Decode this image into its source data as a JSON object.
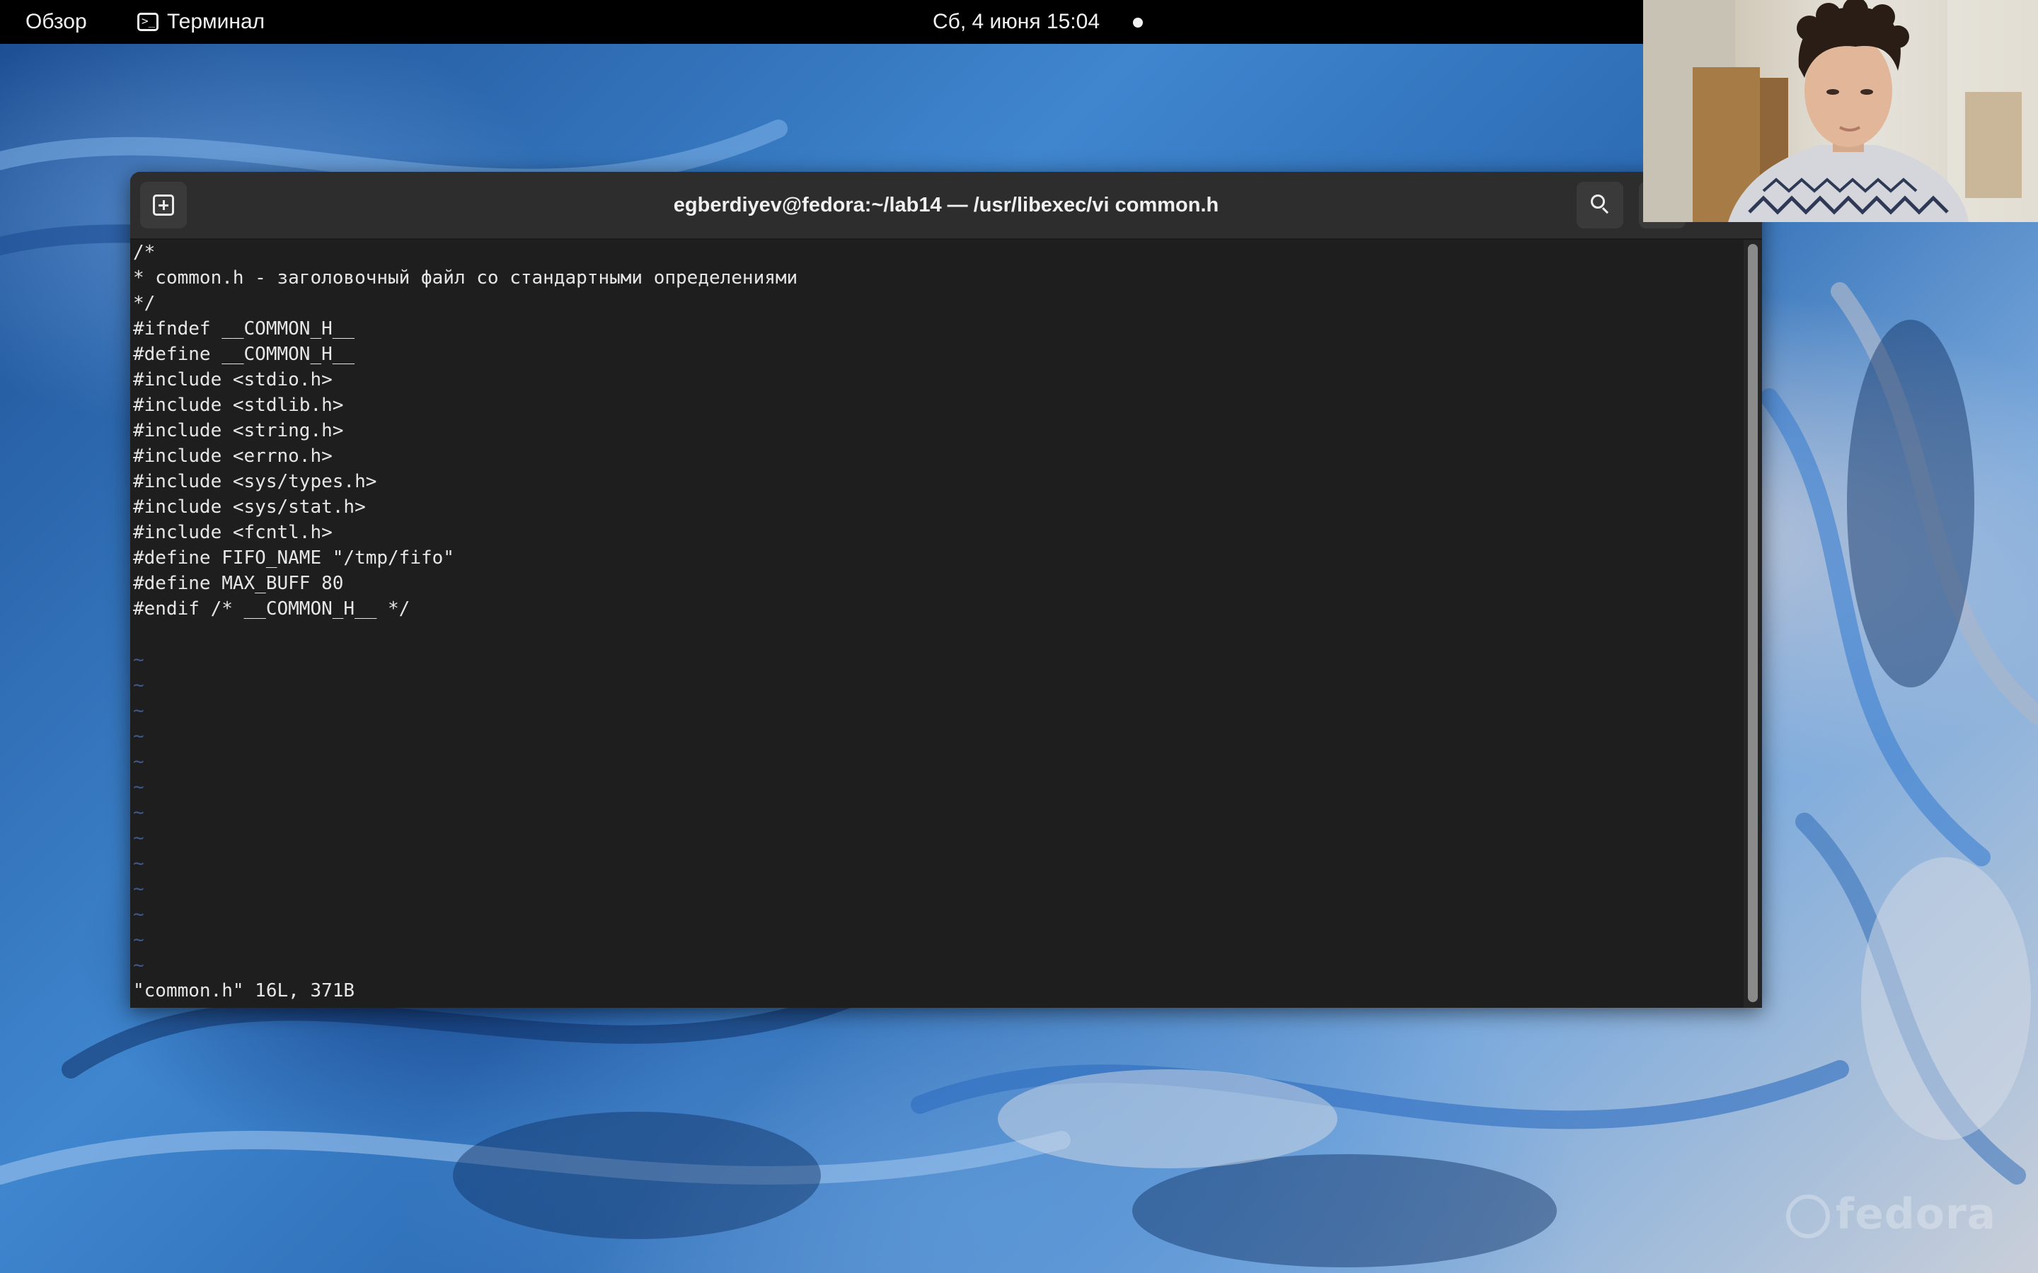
{
  "topbar": {
    "overview_label": "Обзор",
    "app_menu_label": "Терминал",
    "app_icon": "terminal-icon",
    "datetime": "Сб, 4 июня  15:04",
    "status_indicator_icon": "dot-icon"
  },
  "terminal": {
    "title": "egberdiyev@fedora:~/lab14 — /usr/libexec/vi common.h",
    "new_tab_icon": "new-tab-icon",
    "search_icon": "search-icon",
    "lines": [
      "/*",
      "* common.h - заголовочный файл со стандартными определениями",
      "*/",
      "#ifndef __COMMON_H__",
      "#define __COMMON_H__",
      "#include <stdio.h>",
      "#include <stdlib.h>",
      "#include <string.h>",
      "#include <errno.h>",
      "#include <sys/types.h>",
      "#include <sys/stat.h>",
      "#include <fcntl.h>",
      "#define FIFO_NAME \"/tmp/fifo\"",
      "#define MAX_BUFF 80",
      "#endif /* __COMMON_H__ */",
      "",
      "~",
      "~",
      "~",
      "~",
      "~",
      "~",
      "~",
      "~",
      "~",
      "~",
      "~",
      "~",
      "~"
    ],
    "status_line": "\"common.h\" 16L, 371B"
  },
  "wallpaper": {
    "logo_text": "fedora"
  },
  "colors": {
    "topbar_bg": "#000000",
    "terminal_bg": "#1e1e1e",
    "headerbar_bg": "#2d2d2d",
    "tilde_color": "#3e5a8a"
  }
}
